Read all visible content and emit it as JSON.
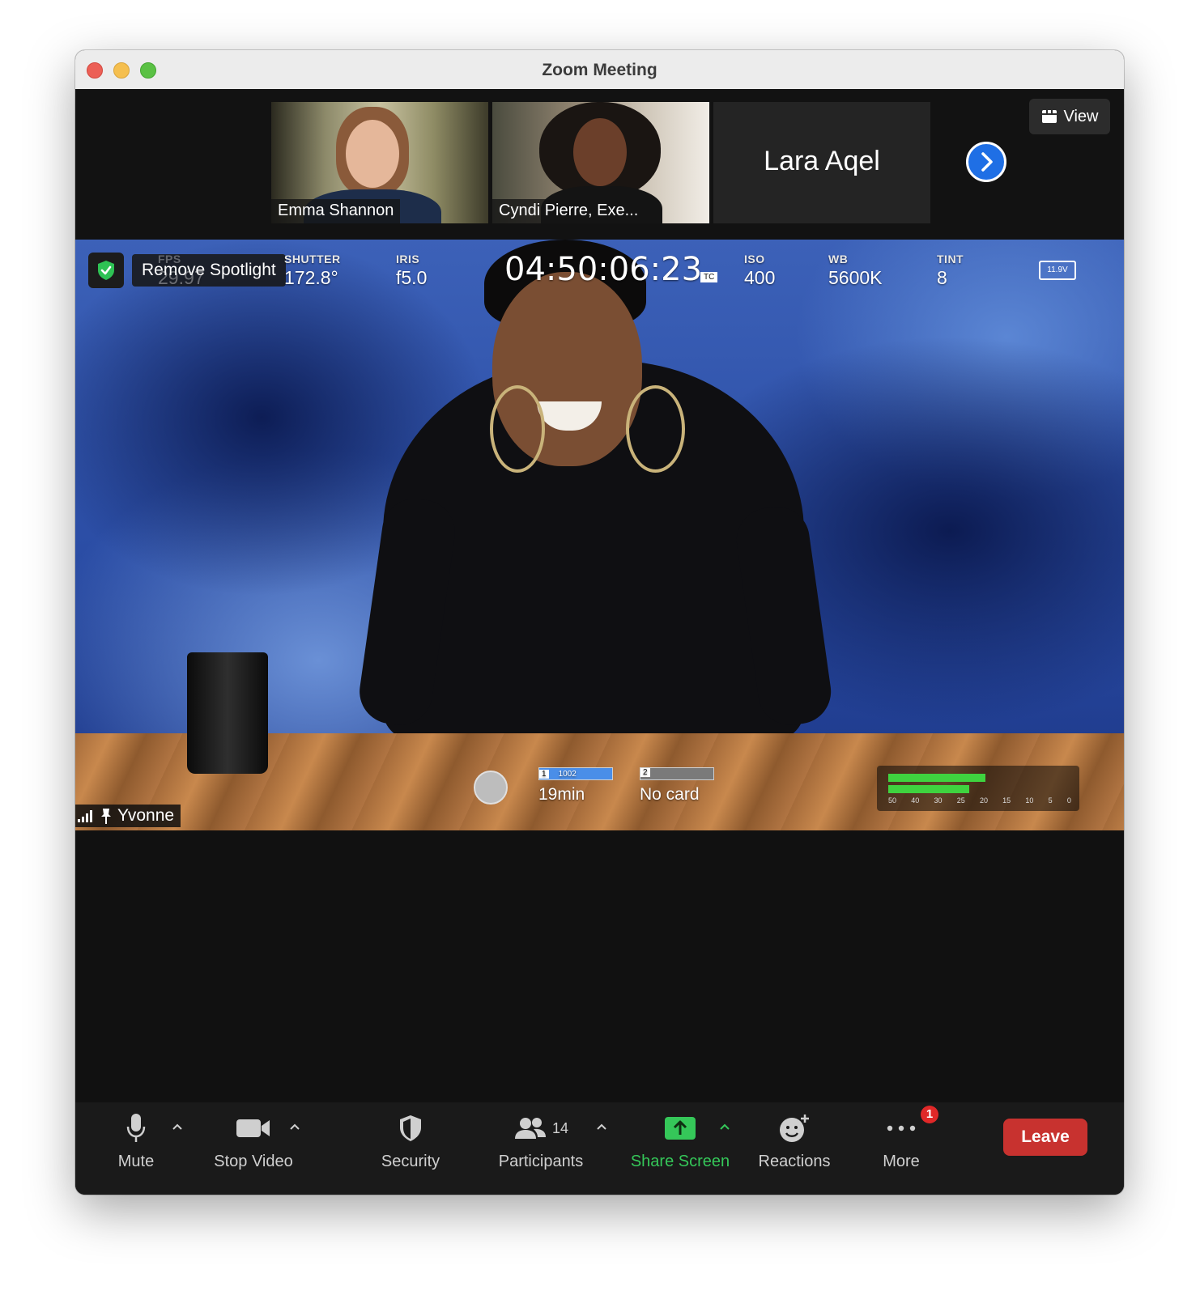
{
  "window": {
    "title": "Zoom Meeting"
  },
  "gallery": {
    "participants": [
      {
        "name": "Emma Shannon"
      },
      {
        "name": "Cyndi Pierre, Exe..."
      },
      {
        "name": "Lara Aqel"
      }
    ],
    "view_label": "View"
  },
  "spotlight": {
    "remove_label": "Remove Spotlight",
    "speaker_name": "Yvonne",
    "camera_hud": {
      "fps_label": "FPS",
      "fps_value": "29.97",
      "shutter_label": "SHUTTER",
      "shutter_value": "172.8°",
      "iris_label": "IRIS",
      "iris_value": "f5.0",
      "timecode": "04:50:06:23",
      "timecode_tag": "TC",
      "iso_label": "ISO",
      "iso_value": "400",
      "wb_label": "WB",
      "wb_value": "5600K",
      "tint_label": "TINT",
      "tint_value": "8",
      "battery": "11.9V",
      "card1_number": "1",
      "card1_bar": "1002",
      "card1_time": "19min",
      "card2_number": "2",
      "card2_status": "No card",
      "meter_ticks": [
        "50",
        "40",
        "30",
        "25",
        "20",
        "15",
        "10",
        "5",
        "0"
      ]
    }
  },
  "toolbar": {
    "mute_label": "Mute",
    "video_label": "Stop Video",
    "security_label": "Security",
    "participants_label": "Participants",
    "participants_count": "14",
    "share_label": "Share Screen",
    "reactions_label": "Reactions",
    "more_label": "More",
    "more_badge": "1",
    "leave_label": "Leave"
  },
  "colors": {
    "share_green": "#35c759",
    "leave_red": "#c8322f",
    "next_blue": "#1f6fe5",
    "shield_green": "#2ec254"
  }
}
